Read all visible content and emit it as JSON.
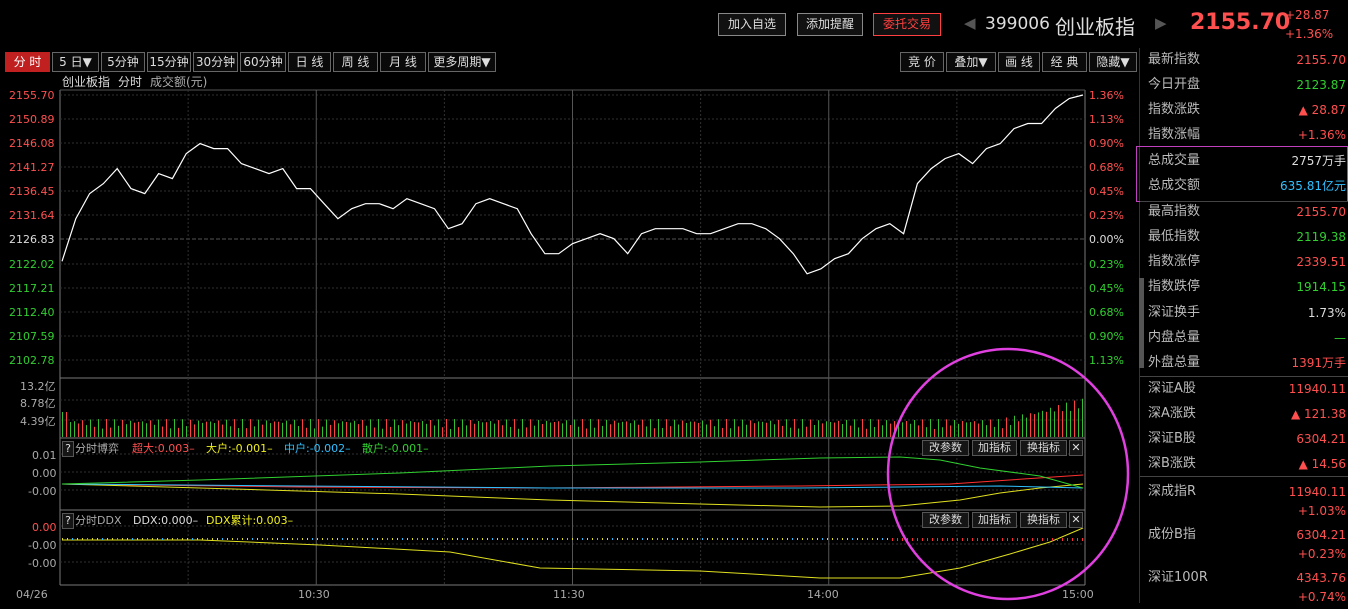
{
  "toolbar": {
    "add_watchlist": "加入自选",
    "add_alert": "添加提醒",
    "trade": "委托交易",
    "code": "399006",
    "name": "创业板指",
    "price": "2155.70",
    "change": "+28.87",
    "change_pct": "+1.36%"
  },
  "tabs": [
    "分 时",
    "5 日▼",
    "5分钟",
    "15分钟",
    "30分钟",
    "60分钟",
    "日 线",
    "周 线",
    "月 线",
    "更多周期▼"
  ],
  "right_tools": [
    "竞 价",
    "叠加▼",
    "画 线",
    "经 典",
    "隐藏▼"
  ],
  "chart_header": {
    "name": "创业板指",
    "mode": "分时",
    "metric": "成交额(元)"
  },
  "price_axis": [
    "2155.70",
    "2150.89",
    "2146.08",
    "2141.27",
    "2136.45",
    "2131.64",
    "2126.83",
    "2122.02",
    "2117.21",
    "2112.40",
    "2107.59",
    "2102.78"
  ],
  "pct_axis": [
    "1.36%",
    "1.13%",
    "0.90%",
    "0.68%",
    "0.45%",
    "0.23%",
    "0.00%",
    "0.23%",
    "0.45%",
    "0.68%",
    "0.90%",
    "1.13%"
  ],
  "vol_axis": [
    "13.2亿",
    "8.78亿",
    "4.39亿"
  ],
  "indicator1": {
    "name": "分时博弈",
    "chaoda": "超大:0.003–",
    "dahu": "大户:-0.001–",
    "zhonghu": "中户:-0.002–",
    "sanhu": "散户:-0.001–",
    "axis": [
      "0.01",
      "0.00",
      "-0.00"
    ]
  },
  "indicator2": {
    "name": "分时DDX",
    "ddx": "DDX:0.000–",
    "ddx_sum": "DDX累计:0.003–",
    "axis": [
      "0.00",
      "-0.00",
      "-0.00"
    ]
  },
  "panel_buttons": [
    "改参数",
    "加指标",
    "换指标"
  ],
  "close_glyph": "✕",
  "help_glyph": "?",
  "time_axis": [
    "04/26",
    "10:30",
    "11:30",
    "14:00",
    "15:00"
  ],
  "quote": [
    {
      "k": "最新指数",
      "v": "2155.70",
      "c": "red"
    },
    {
      "k": "今日开盘",
      "v": "2123.87",
      "c": "green"
    },
    {
      "k": "指数涨跌",
      "v": "▲ 28.87",
      "c": "red"
    },
    {
      "k": "指数涨幅",
      "v": "+1.36%",
      "c": "red"
    },
    {
      "k": "总成交量",
      "v": "2757万手",
      "c": "white"
    },
    {
      "k": "总成交额",
      "v": "635.81亿元",
      "c": "cyan"
    },
    {
      "k": "最高指数",
      "v": "2155.70",
      "c": "red"
    },
    {
      "k": "最低指数",
      "v": "2119.38",
      "c": "green"
    },
    {
      "k": "指数涨停",
      "v": "2339.51",
      "c": "red"
    },
    {
      "k": "指数跌停",
      "v": "1914.15",
      "c": "green"
    },
    {
      "k": "深证换手",
      "v": "1.73%",
      "c": "white"
    },
    {
      "k": "内盘总量",
      "v": "—",
      "c": "green"
    },
    {
      "k": "外盘总量",
      "v": "1391万手",
      "c": "red"
    },
    {
      "k": "深证A股",
      "v": "11940.11",
      "c": "red"
    },
    {
      "k": "深A涨跌",
      "v": "▲ 121.38",
      "c": "red"
    },
    {
      "k": "深证B股",
      "v": "6304.21",
      "c": "red"
    },
    {
      "k": "深B涨跌",
      "v": "▲ 14.56",
      "c": "red"
    }
  ],
  "indices": [
    {
      "k": "深成指R",
      "v": "11940.11",
      "pct": "+1.03%"
    },
    {
      "k": "成份B指",
      "v": "6304.21",
      "pct": "+0.23%"
    },
    {
      "k": "深证100R",
      "v": "4343.76",
      "pct": "+0.74%"
    }
  ],
  "colors": {
    "up": "#ff5050",
    "down": "#30d030",
    "line": "#ffffff",
    "highlight_circle": "#e040e0"
  },
  "chart_data": {
    "type": "line",
    "title": "创业板指 分时",
    "prev_close": 2126.83,
    "ylim": [
      2102.78,
      2155.7
    ],
    "x_ticks": [
      "04/26",
      "10:30",
      "11:30",
      "14:00",
      "15:00"
    ],
    "series": [
      {
        "name": "创业板指",
        "values": [
          2122.5,
          2131,
          2136,
          2138,
          2141,
          2137,
          2136,
          2140,
          2139,
          2144,
          2146,
          2145,
          2145,
          2142,
          2141,
          2140,
          2141,
          2137,
          2137,
          2134,
          2131,
          2133,
          2134,
          2134,
          2133,
          2135,
          2134,
          2133,
          2129,
          2130,
          2134,
          2135,
          2134,
          2133,
          2128,
          2124,
          2124,
          2126,
          2127,
          2128,
          2127,
          2124,
          2128,
          2129,
          2129,
          2129,
          2128,
          2128,
          2129,
          2130,
          2130,
          2129,
          2127,
          2124,
          2120,
          2121,
          2123,
          2124,
          2127,
          2129,
          2130,
          2128,
          2138,
          2141,
          2143,
          2144,
          2142,
          2145,
          2146,
          2149,
          2150,
          2150,
          2153,
          2155,
          2155.7
        ]
      }
    ]
  }
}
